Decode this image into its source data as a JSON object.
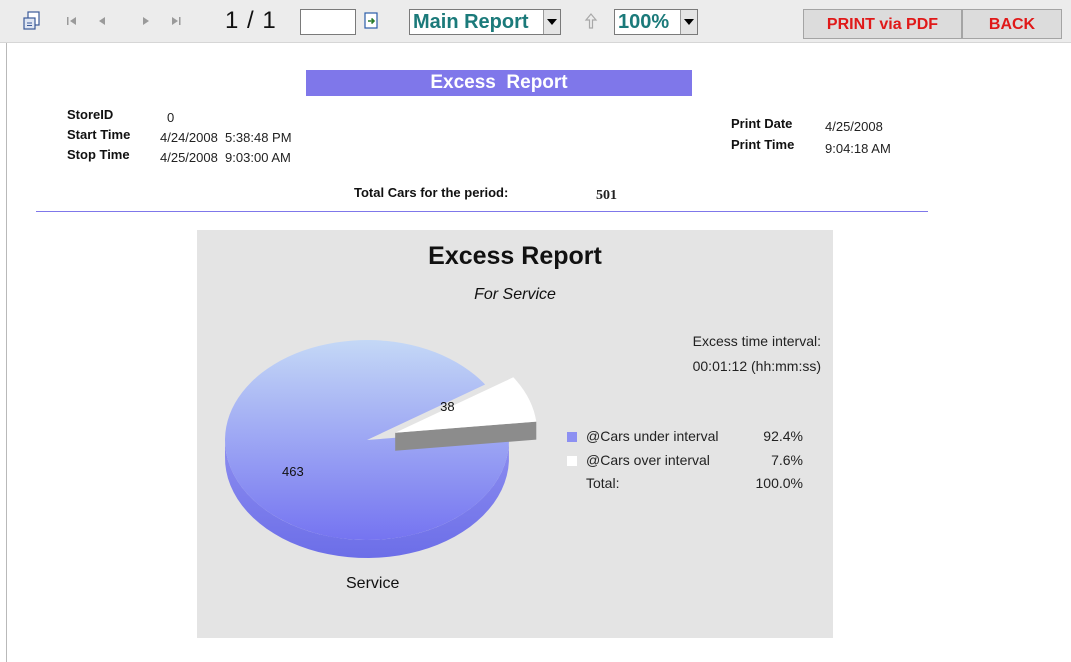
{
  "toolbar": {
    "page_indicator": "1 / 1",
    "goto_value": "",
    "report_select": "Main Report",
    "zoom_select": "100%",
    "print_pdf_label": "PRINT via PDF",
    "back_label": "BACK"
  },
  "report": {
    "title": "Excess  Report",
    "store_id_label": "StoreID",
    "store_id_value": "0",
    "start_time_label": "Start Time",
    "start_time_value": "4/24/2008  5:38:48 PM",
    "stop_time_label": "Stop Time",
    "stop_time_value": "4/25/2008  9:03:00 AM",
    "print_date_label": "Print Date",
    "print_date_value": "4/25/2008",
    "print_time_label": "Print Time",
    "print_time_value": "9:04:18 AM",
    "total_cars_label": "Total Cars for the period:",
    "total_cars_value": "501"
  },
  "colors": {
    "accent": "#7f77ea",
    "button_text": "#e01919",
    "panel_bg": "#e4e4e4"
  },
  "chart_data": {
    "type": "pie",
    "title": "Excess Report",
    "subtitle": "For Service",
    "excess_label_line1": "Excess time interval:",
    "excess_label_line2": "00:01:12 (hh:mm:ss)",
    "category_label": "Service",
    "slices": [
      {
        "name": "@Cars under interval",
        "value": 463,
        "percent": "92.4%",
        "color": "#8d90f2"
      },
      {
        "name": "@Cars over interval",
        "value": 38,
        "percent": "7.6%",
        "color": "#ffffff"
      }
    ],
    "total_label": "Total:",
    "total_percent": "100.0%"
  }
}
